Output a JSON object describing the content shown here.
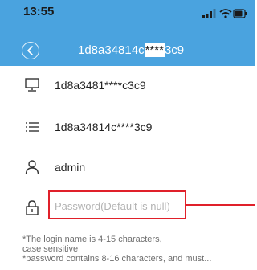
{
  "status_bar": {
    "time": "13:55"
  },
  "header": {
    "title_prefix": "1d8a34814c",
    "title_mask": "****",
    "title_suffix": "3c9",
    "background_color": "#4aa3df"
  },
  "device": {
    "serial": "1d8a3481****c3c9",
    "device_id": "1d8a34814c****3c9",
    "username": "admin"
  },
  "password": {
    "placeholder": "Password(Default is null)",
    "value": ""
  },
  "notes": {
    "line1": "*The login name is 4-15 characters,",
    "line2": "case sensitive",
    "line3": "*password contains 8-16 characters, and must..."
  },
  "colors": {
    "accent": "#4aa3df",
    "highlight": "#e0202a"
  },
  "icons": {
    "back": "back-arrow-icon",
    "device": "monitor-icon",
    "id": "list-icon",
    "user": "person-icon",
    "password": "lock-icon"
  }
}
